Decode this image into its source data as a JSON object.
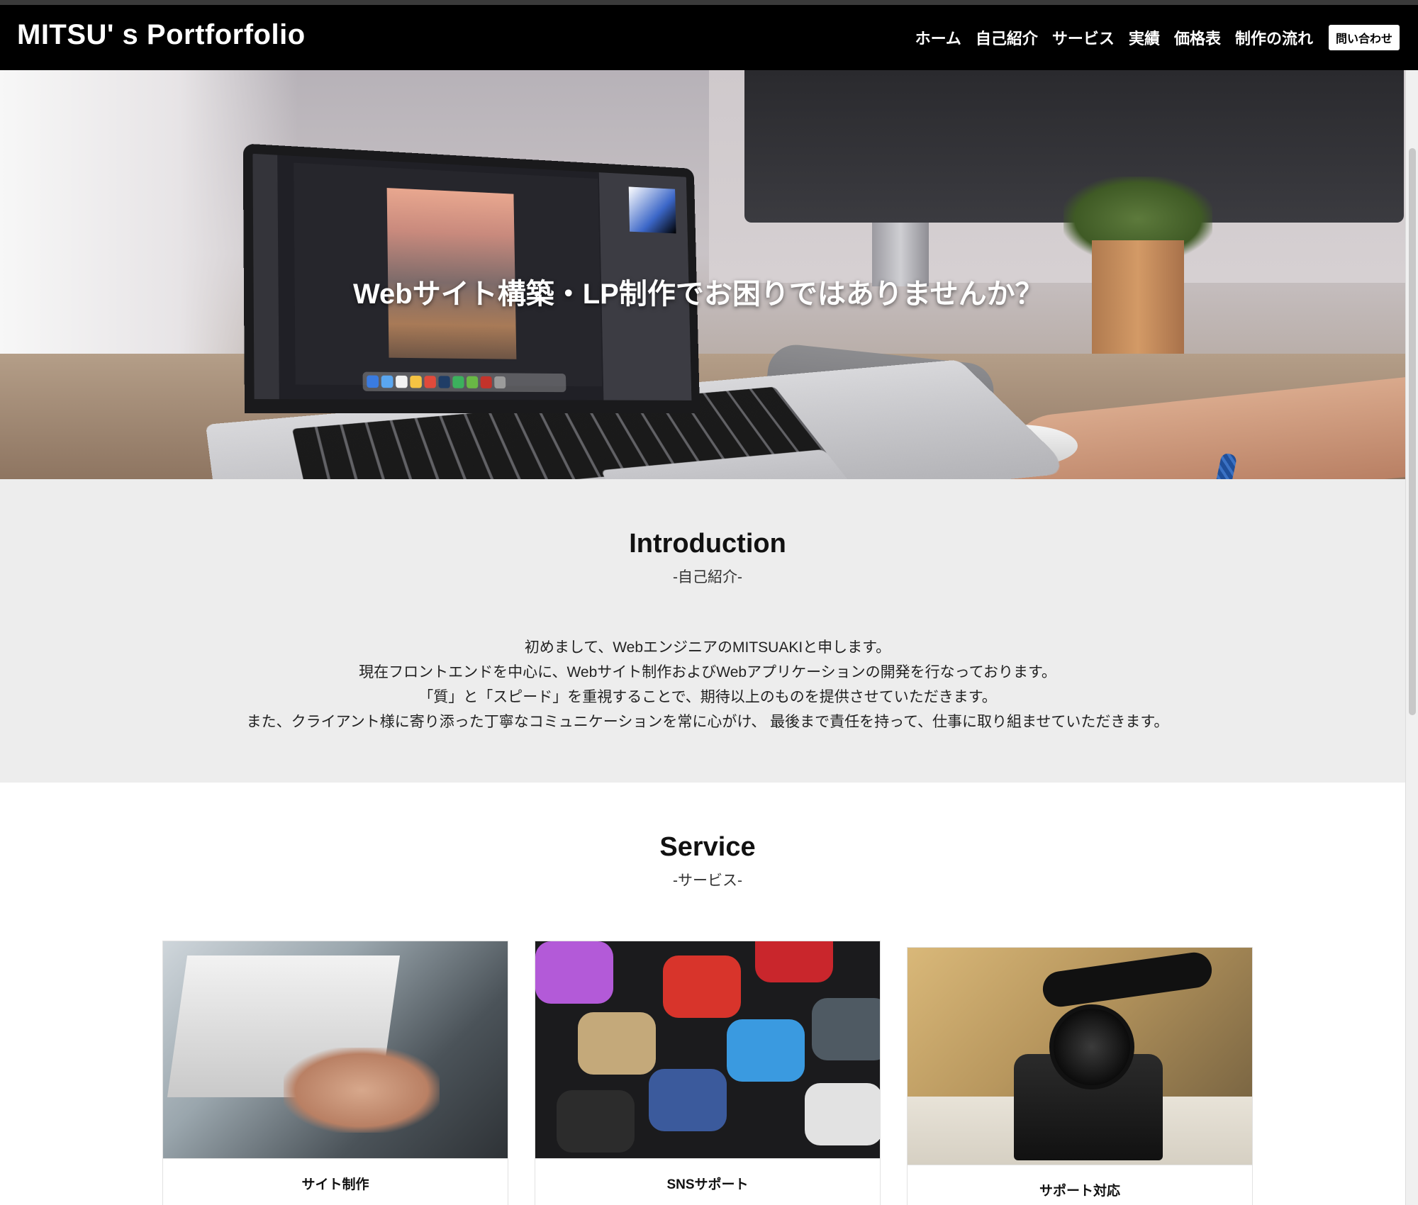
{
  "header": {
    "site_title": "MITSU' s Portforfolio",
    "nav": [
      "ホーム",
      "自己紹介",
      "サービス",
      "実績",
      "価格表",
      "制作の流れ"
    ],
    "contact_label": "問い合わせ"
  },
  "hero": {
    "heading": "Webサイト構築・LP制作でお困りではありませんか？"
  },
  "introduction": {
    "title": "Introduction",
    "subtitle": "-自己紹介-",
    "lines": [
      "初めまして、WebエンジニアのMITSUAKIと申します。",
      "現在フロントエンドを中心に、Webサイト制作およびWebアプリケーションの開発を行なっております。",
      "「質」と「スピード」を重視することで、期待以上のものを提供させていただきます。",
      "また、クライアント様に寄り添った丁寧なコミュニケーションを常に心がけ、 最後まで責任を持って、仕事に取り組ませていただきます。"
    ]
  },
  "service": {
    "title": "Service",
    "subtitle": "-サービス-",
    "cards": [
      {
        "label": "サイト制作"
      },
      {
        "label": "SNSサポート"
      },
      {
        "label": "サポート対応"
      }
    ]
  },
  "colors": {
    "header_bg": "#000000",
    "intro_bg": "#ededed",
    "accent_text": "#ffffff"
  },
  "icons": {
    "scrollbar": "vertical-scrollbar"
  }
}
